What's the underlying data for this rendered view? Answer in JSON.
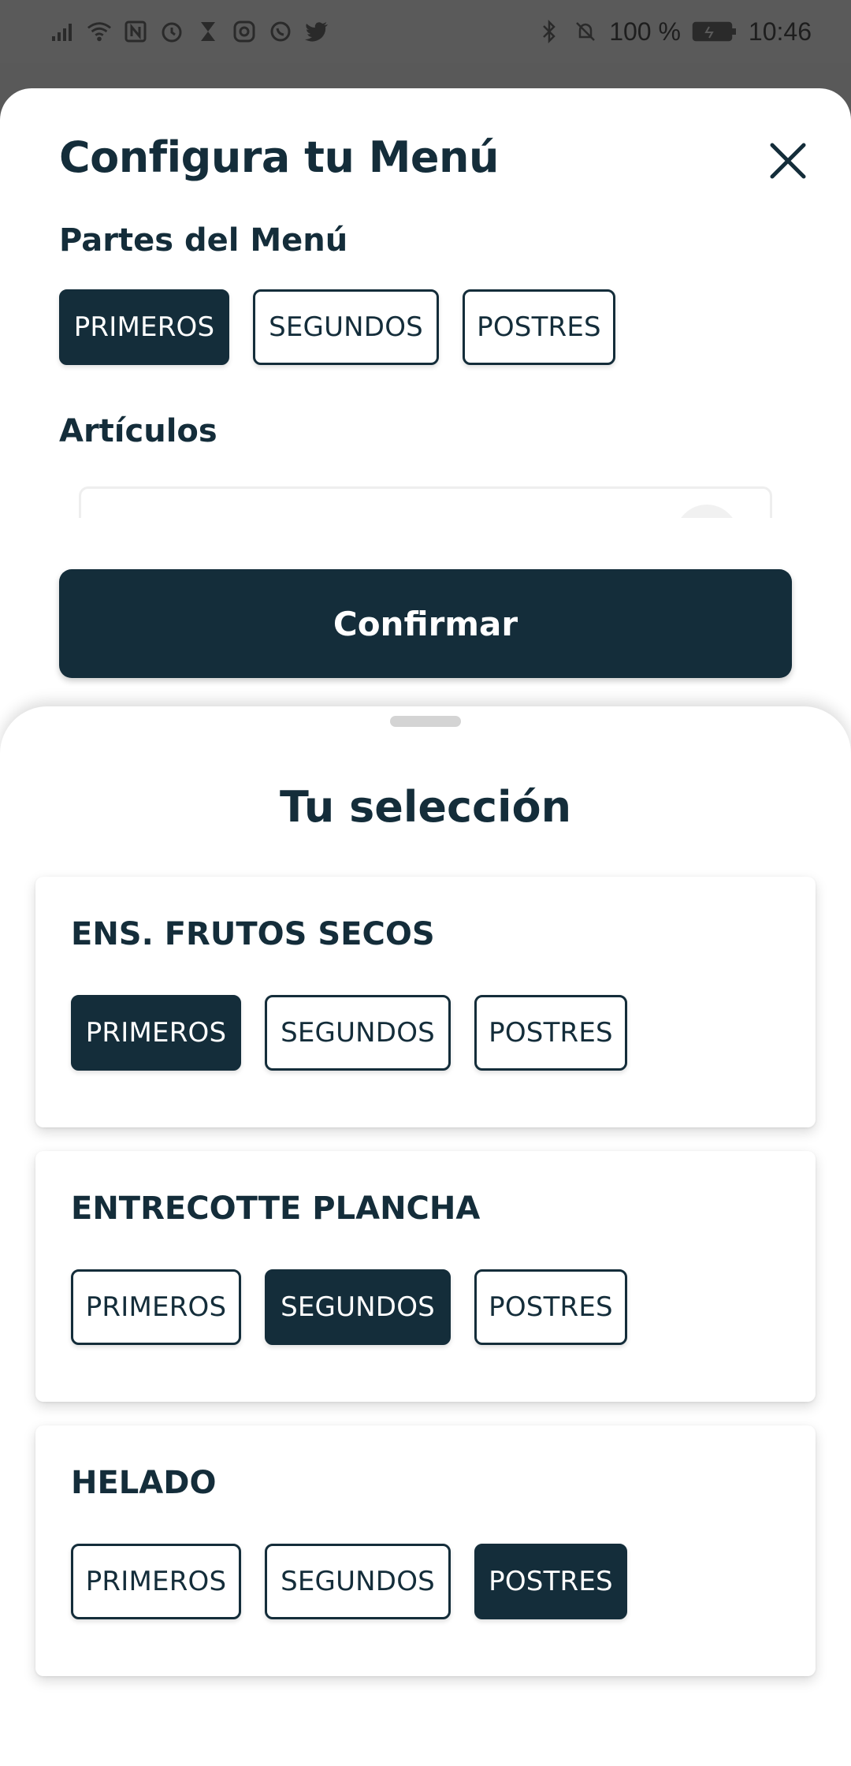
{
  "status_bar": {
    "battery_percent": "100 %",
    "time": "10:46"
  },
  "config": {
    "title": "Configura tu Menú",
    "parts_label": "Partes del Menú",
    "parts": [
      {
        "label": "PRIMEROS",
        "active": true
      },
      {
        "label": "SEGUNDOS",
        "active": false
      },
      {
        "label": "POSTRES",
        "active": false
      }
    ],
    "articles_label": "Artículos",
    "confirm_label": "Confirmar"
  },
  "selection": {
    "title": "Tu selección",
    "items": [
      {
        "name": "ENS. FRUTOS SECOS",
        "chips": [
          "PRIMEROS",
          "SEGUNDOS",
          "POSTRES"
        ],
        "active": "PRIMEROS"
      },
      {
        "name": "ENTRECOTTE PLANCHA",
        "chips": [
          "PRIMEROS",
          "SEGUNDOS",
          "POSTRES"
        ],
        "active": "SEGUNDOS"
      },
      {
        "name": "HELADO",
        "chips": [
          "PRIMEROS",
          "SEGUNDOS",
          "POSTRES"
        ],
        "active": "POSTRES"
      }
    ]
  },
  "colors": {
    "primary": "#142d3a",
    "background": "#ffffff",
    "overlay": "#595959"
  }
}
